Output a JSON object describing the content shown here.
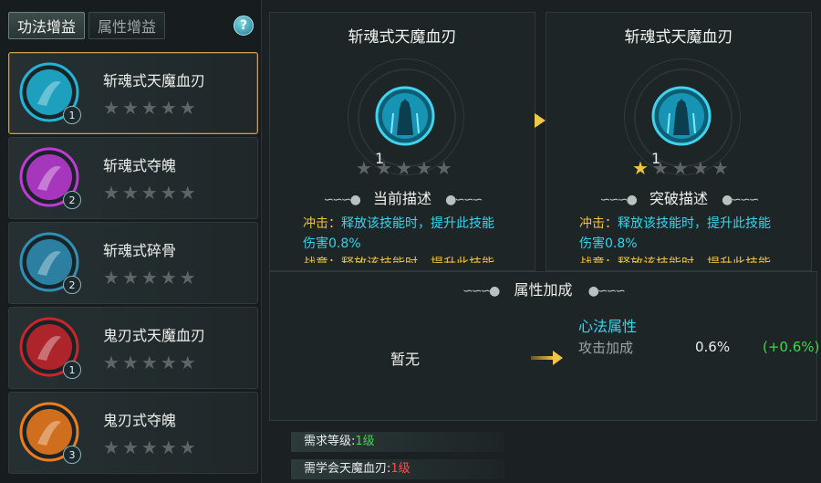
{
  "tabs": [
    {
      "label": "功法增益",
      "active": true
    },
    {
      "label": "属性增益",
      "active": false
    }
  ],
  "help_label": "?",
  "skills": [
    {
      "name": "斩魂式天魔血刃",
      "level": "1",
      "stars": 0,
      "color": "#1fb6d8"
    },
    {
      "name": "斩魂式夺魄",
      "level": "2",
      "stars": 0,
      "color": "#c03ad6"
    },
    {
      "name": "斩魂式碎骨",
      "level": "2",
      "stars": 0,
      "color": "#2f8fb5"
    },
    {
      "name": "鬼刃式天魔血刃",
      "level": "1",
      "stars": 0,
      "color": "#c8262b"
    },
    {
      "name": "鬼刃式夺魄",
      "level": "3",
      "stars": 0,
      "color": "#f07d1c"
    }
  ],
  "current_panel": {
    "title": "斩魂式天魔血刃",
    "level": "1",
    "stars": 0,
    "section": "当前描述",
    "desc_key": "冲击：",
    "desc_line1": "释放该技能时，提升此技能",
    "desc_line2": "伤害0.8%",
    "desc_line3": "战意：释放该技能时，提升此技能"
  },
  "breakthrough_panel": {
    "title": "斩魂式天魔血刃",
    "level": "1",
    "stars": 1,
    "section": "突破描述",
    "desc_key": "冲击：",
    "desc_line1": "释放该技能时，提升此技能",
    "desc_line2": "伤害0.8%",
    "desc_line3": "战意：释放该技能时，提升此技能"
  },
  "attributes": {
    "title": "属性加成",
    "current": "暂无",
    "category": "心法属性",
    "stat_name": "攻击加成",
    "stat_value": "0.6%",
    "stat_delta": "(+0.6%)"
  },
  "requirements": [
    {
      "label": "需求等级:",
      "value": "1级",
      "met": true
    },
    {
      "label": "需学会天魔血刃:",
      "value": "1级",
      "met": false
    }
  ]
}
